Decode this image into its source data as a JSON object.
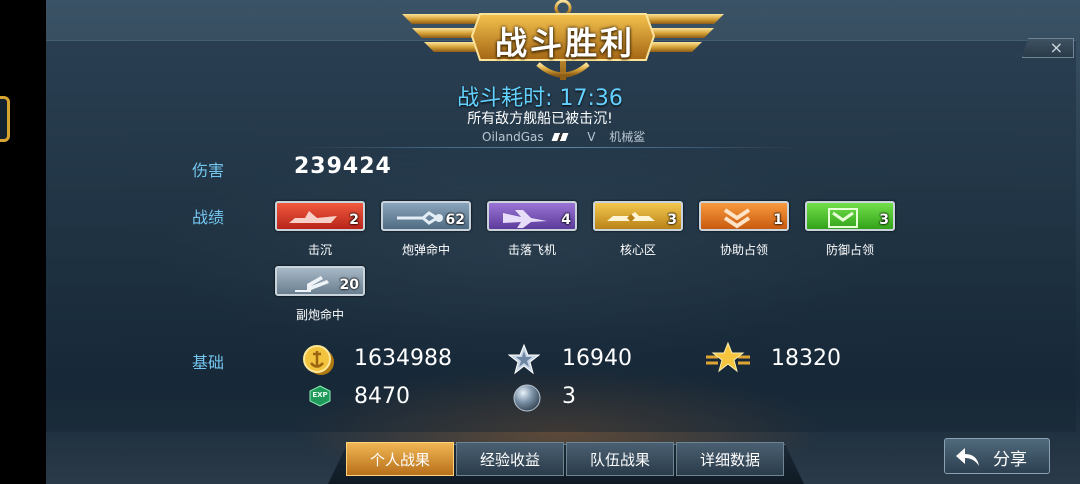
{
  "header": {
    "title": "战斗胜利",
    "close_icon": "close-icon",
    "close_glyph": "×"
  },
  "battle": {
    "time_text": "战斗耗时: 17:36",
    "result_text": "所有敌方舰船已被击沉!",
    "opponent_name": "OilandGas",
    "opponent_tier": "V",
    "opponent_type": "机械鲨"
  },
  "labels": {
    "damage": "伤害",
    "achievements": "战绩",
    "basic": "基础"
  },
  "damage_value": "239424",
  "medals": [
    {
      "name": "击沉",
      "count": "2",
      "color": "#d8352a",
      "icon": "sink-ship-icon"
    },
    {
      "name": "炮弹命中",
      "count": "62",
      "color": "#5f7f9a",
      "icon": "shell-hit-icon"
    },
    {
      "name": "击落飞机",
      "count": "4",
      "color": "#6f4fb0",
      "icon": "plane-shot-icon"
    },
    {
      "name": "核心区",
      "count": "3",
      "color": "#d6a12a",
      "icon": "core-zone-icon"
    },
    {
      "name": "协助占领",
      "count": "1",
      "color": "#e57a22",
      "icon": "assist-capture-icon"
    },
    {
      "name": "防御占领",
      "count": "3",
      "color": "#4fc22a",
      "icon": "defend-capture-icon"
    },
    {
      "name": "副炮命中",
      "count": "20",
      "color": "#7a8c9c",
      "icon": "secondary-gun-icon"
    }
  ],
  "basic": {
    "coins": "1634988",
    "silver_star": "16940",
    "gold_star": "18320",
    "exp": "8470",
    "sphere": "3",
    "coins_icon": "gold-coin-icon",
    "silver_star_icon": "silver-star-icon",
    "gold_star_icon": "gold-star-icon",
    "exp_icon": "exp-icon",
    "sphere_icon": "sphere-icon",
    "exp_badge": "EXP"
  },
  "tabs": [
    {
      "label": "个人战果",
      "active": true
    },
    {
      "label": "经验收益",
      "active": false
    },
    {
      "label": "队伍战果",
      "active": false
    },
    {
      "label": "详细数据",
      "active": false
    }
  ],
  "share": {
    "label": "分享",
    "icon": "share-arrow-icon"
  }
}
